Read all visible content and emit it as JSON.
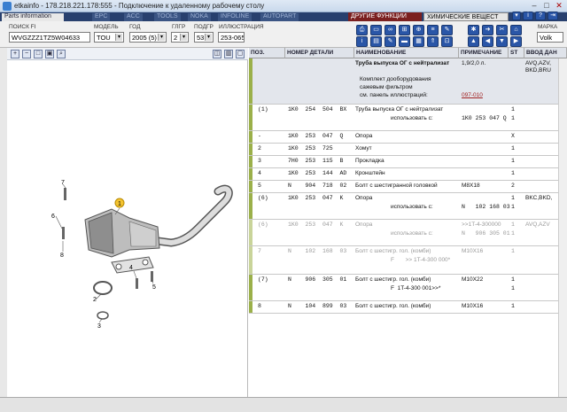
{
  "window": {
    "title": "etkainfo - 178.218.221.178:555 - Подключение к удаленному рабочему столу"
  },
  "menu": {
    "tabs": [
      "Parts information",
      "EPC",
      "ACC",
      "TOOLS",
      "NOKA",
      "INFOLINE",
      "AUTOPART"
    ],
    "right_tab": "ДРУГИЕ ФУНКЦИИ",
    "right_select": "ХИМИЧЕСКИЕ ВЕЩЕСТ"
  },
  "filters": {
    "search_label": "ПОИСК FI",
    "search_value": "WVGZZZ1TZ5W04633",
    "model_label": "МОДЕЛЬ",
    "model_value": "TOU",
    "year_label": "ГОД",
    "year_value": "2005 (5)",
    "group_label": "ГЛГР",
    "group_value": "2",
    "subgroup_label": "ПОДГР",
    "subgroup_value": "53",
    "illus_label": "ИЛЛЮСТРАЦИЯ",
    "illus_value": "253-065",
    "brand_label": "МАРКА",
    "brand_value": "Volk"
  },
  "table": {
    "headers": [
      "ПОЗ.",
      "НОМЕР ДЕТАЛИ",
      "НАИМЕНОВАНИЕ",
      "ПРИМЕЧАНИЕ",
      "ST",
      "ВВОД ДАН"
    ],
    "header_row": {
      "name": "Труба выпуска ОГ с нейтрализат",
      "note": "1,9/2,0 л.",
      "input": "AVQ,AZV,",
      "input2": "BKD,BRU"
    },
    "kit": {
      "line1": "Комплект дооборудования",
      "line2": "сажевым фильтром",
      "line3": "см. панель иллюстраций:",
      "link": "097-010"
    },
    "rows": [
      {
        "pos": "(1)",
        "part": "1K0  254  504  BX",
        "name": "Труба выпуска ОГ с нейтрализат",
        "sub": "использовать с:",
        "subpart": "1K0 253 047 Q",
        "st": "1",
        "st2": "1",
        "note": "",
        "input": ""
      },
      {
        "pos": "-",
        "part": "1K0  253  047  Q",
        "name": "Опора",
        "sub": "",
        "subpart": "",
        "st": "X",
        "st2": "",
        "note": "",
        "input": ""
      },
      {
        "pos": "2",
        "part": "1K0  253  725",
        "name": "Хомут",
        "sub": "",
        "subpart": "",
        "st": "1",
        "st2": "",
        "note": "",
        "input": ""
      },
      {
        "pos": "3",
        "part": "7H0  253  115  B",
        "name": "Прокладка",
        "sub": "",
        "subpart": "",
        "st": "1",
        "st2": "",
        "note": "",
        "input": ""
      },
      {
        "pos": "4",
        "part": "1K0  253  144  AD",
        "name": "Кронштейн",
        "sub": "",
        "subpart": "",
        "st": "1",
        "st2": "",
        "note": "",
        "input": ""
      },
      {
        "pos": "5",
        "part": "N    904  718  02",
        "name": "Болт с шестигранной головкой",
        "sub": "",
        "subpart": "",
        "st": "2",
        "st2": "",
        "note": "M8X18",
        "input": ""
      },
      {
        "pos": "(6)",
        "part": "1K0  253  047  K",
        "name": "Опора",
        "sub": "использовать с:",
        "subpart": "N   102 168 03",
        "st": "1",
        "st2": "1",
        "note": "",
        "input": "BKC,BKD,"
      },
      {
        "pos": "(6)",
        "part": "1K0  253  047  K",
        "name": "Опора",
        "sub": "использовать с:",
        "subpart": "N   906 305 01",
        "st": "1",
        "st2": "1",
        "note": ">>1T-4-300000",
        "input": "AVQ,AZV"
      },
      {
        "pos": "7",
        "part": "N    102  168  03",
        "name": "Болт с шестигр. гол. (комби)",
        "sub": "F       >> 1T-4-300 000*",
        "subpart": "",
        "st": "1",
        "st2": "",
        "note": "M10X16",
        "input": ""
      },
      {
        "pos": "(7)",
        "part": "N    906  305  01",
        "name": "Болт с шестигр. гол. (комби)",
        "sub": "F  1T-4-300 001>>*",
        "subpart": "",
        "st": "1",
        "st2": "1",
        "note": "M10X22",
        "input": ""
      },
      {
        "pos": "8",
        "part": "N    104  899  03",
        "name": "Болт с шестигр. гол. (комби)",
        "sub": "",
        "subpart": "",
        "st": "1",
        "st2": "",
        "note": "M10X16",
        "input": ""
      }
    ]
  },
  "diagram": {
    "callouts": [
      "1",
      "2",
      "3",
      "4",
      "5",
      "6",
      "7",
      "8"
    ]
  },
  "icons": {
    "zoom_in": "zoom-in-icon",
    "zoom_out": "zoom-out-icon",
    "search": "search-icon"
  },
  "colors": {
    "accent_bar": "#9bb04a",
    "menu_bg": "#28406e",
    "button_blue": "#2a56a7"
  }
}
